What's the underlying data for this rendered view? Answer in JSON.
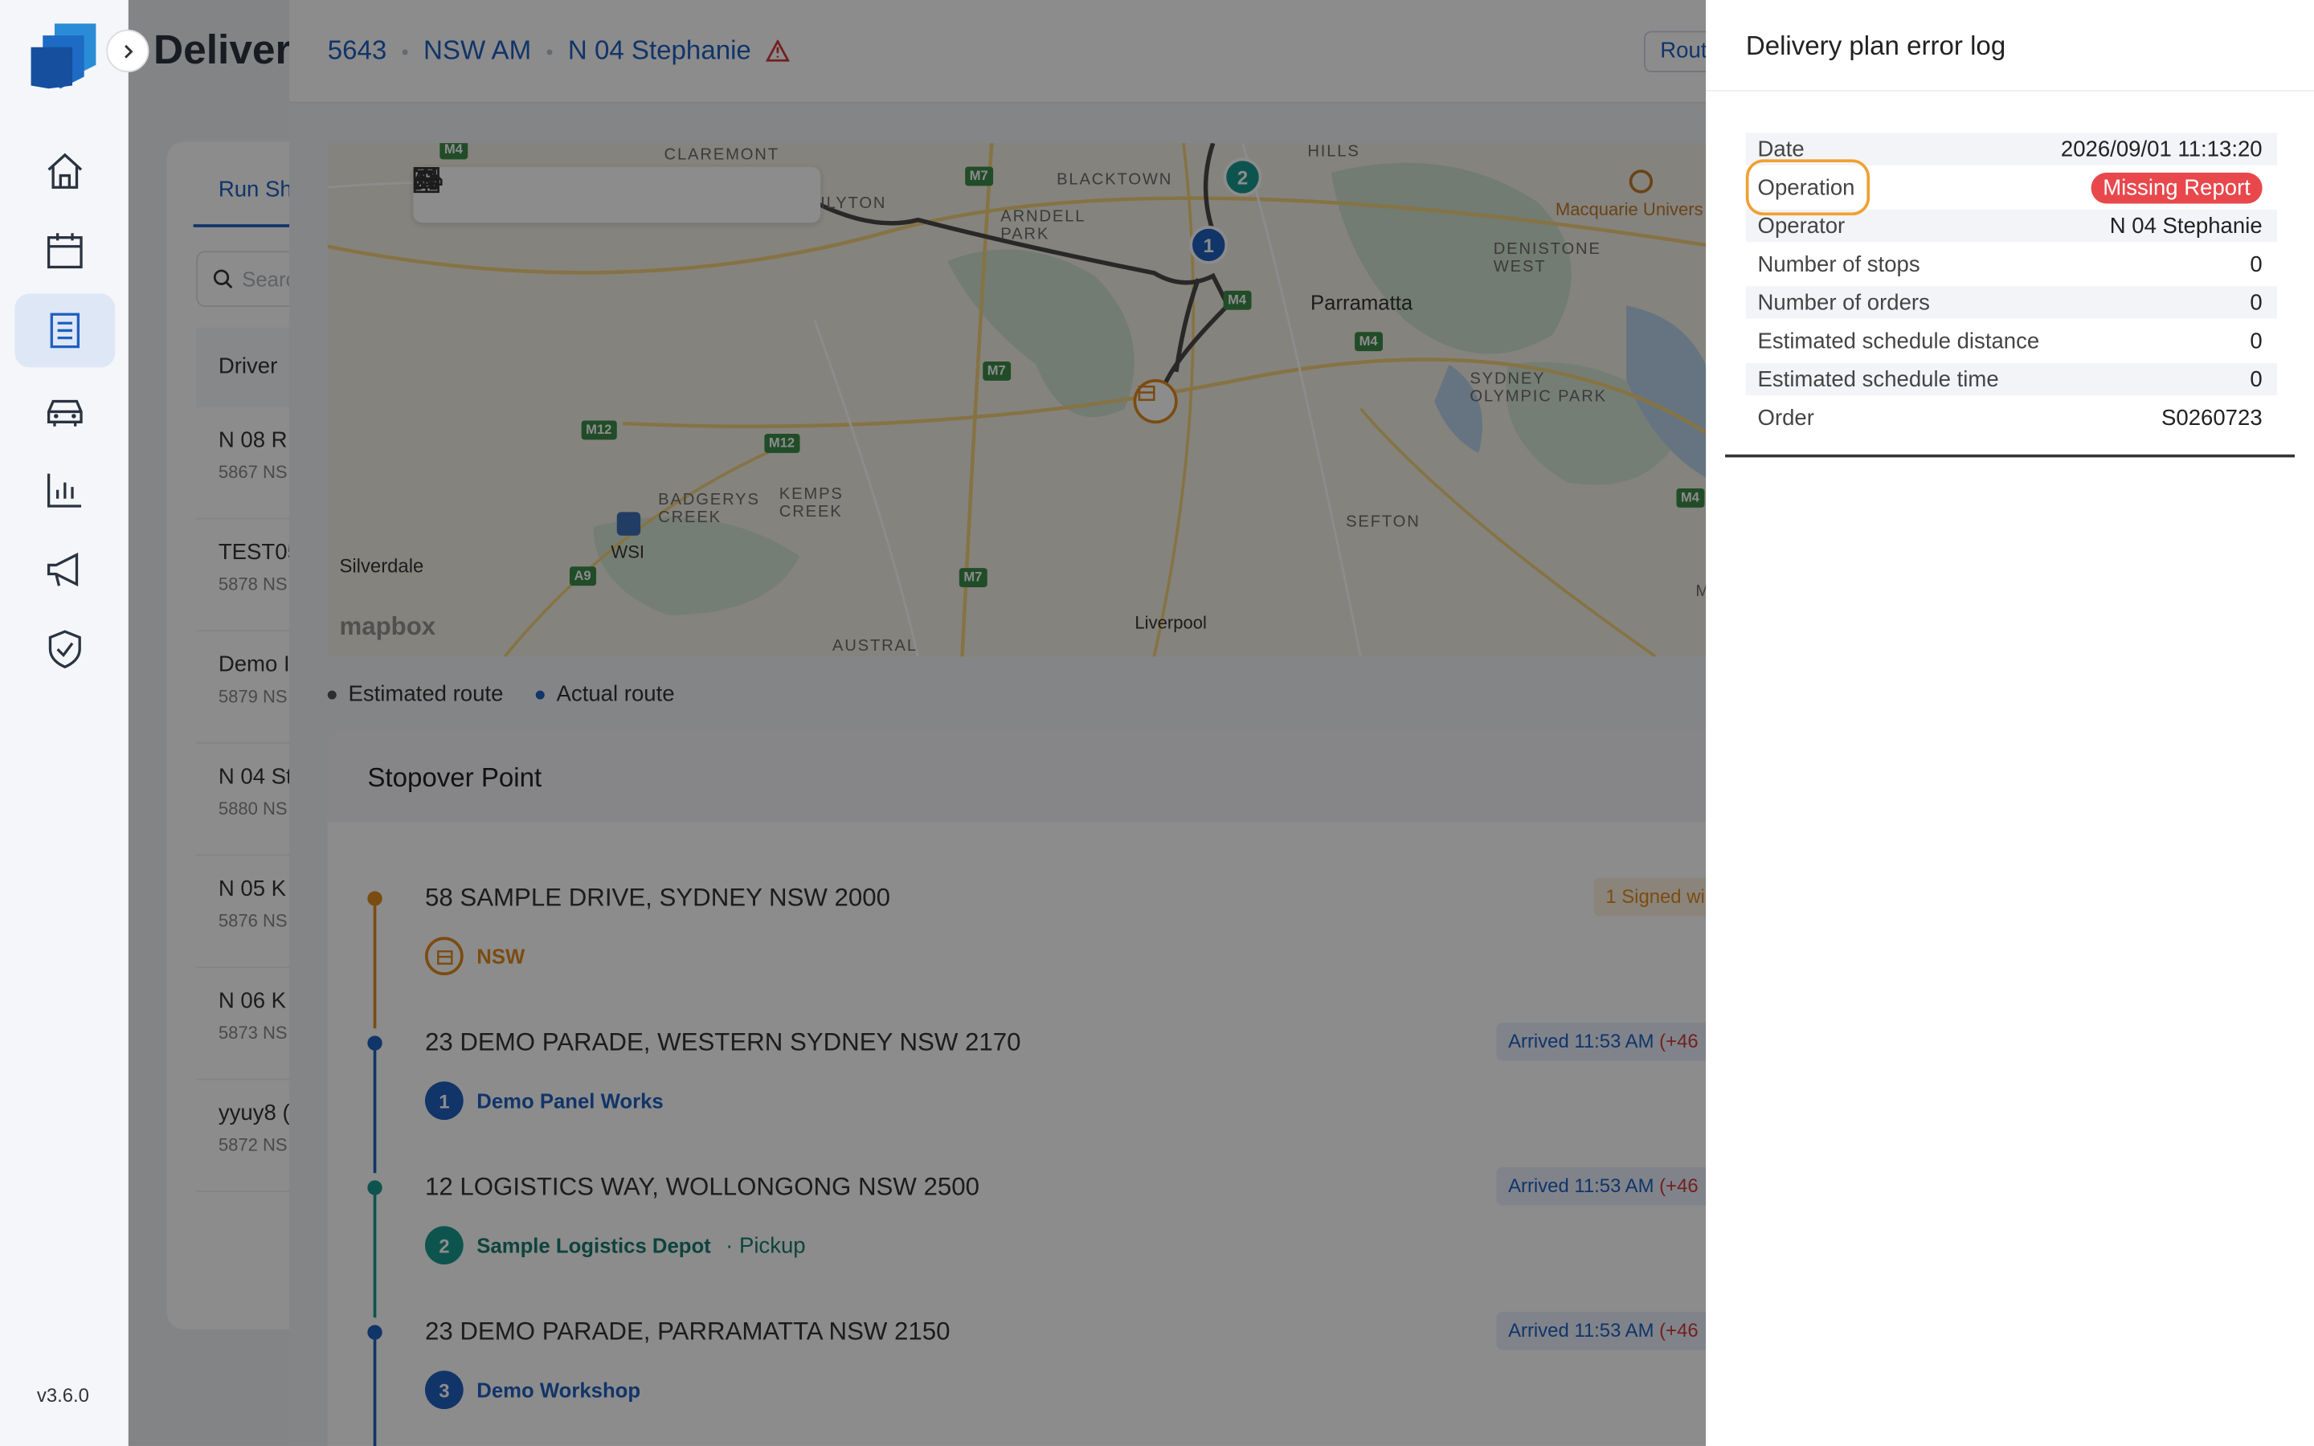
{
  "app": {
    "title": "Delivery",
    "version": "v3.6.0"
  },
  "sidebar": {
    "items": [
      {
        "id": "home",
        "icon": "home-icon"
      },
      {
        "id": "calendar",
        "icon": "calendar-icon"
      },
      {
        "id": "documents",
        "icon": "document-list-icon",
        "active": true
      },
      {
        "id": "vehicles",
        "icon": "car-icon"
      },
      {
        "id": "reports",
        "icon": "bar-chart-icon"
      },
      {
        "id": "announcements",
        "icon": "megaphone-icon"
      },
      {
        "id": "security",
        "icon": "shield-check-icon"
      }
    ]
  },
  "list": {
    "tab_label": "Run Sh",
    "search_placeholder": "Searc",
    "header": "Driver",
    "drivers": [
      {
        "name": "N 08 R",
        "sub": "5867 NS"
      },
      {
        "name": "TEST05",
        "sub": "5878 NS"
      },
      {
        "name": "Demo I",
        "sub": "5879 NS"
      },
      {
        "name": "N 04 St",
        "sub": "5880 NS"
      },
      {
        "name": "N 05 K",
        "sub": "5876 NS"
      },
      {
        "name": "N 06 K",
        "sub": "5873 NS"
      },
      {
        "name": "yyuy8 (",
        "sub": "5872 NS"
      }
    ]
  },
  "breadcrumb": {
    "id": "5643",
    "region": "NSW AM",
    "driver": "N 04 Stephanie"
  },
  "route_button": "Rout",
  "map": {
    "labels": [
      "CLAREMONT",
      "BLACKTOWN",
      "ARNDELL PARK",
      "HILLS",
      "Macquarie Univers",
      "DENISTONE WEST",
      "Parramatta",
      "SYDNEY OLYMPIC PARK",
      "BADGERYS CREEK",
      "KEMPS CREEK",
      "WSI",
      "Silverdale",
      "SEFTON",
      "Liverpool",
      "AUSTRAL",
      "ILYTON",
      "MA"
    ],
    "shields": [
      "M4",
      "M7",
      "M4",
      "M4",
      "M7",
      "M12",
      "M12",
      "M7",
      "A9",
      "M4"
    ],
    "pins": [
      "1",
      "2"
    ],
    "attribution": "mapbox"
  },
  "legend": {
    "estimated": "Estimated route",
    "actual": "Actual route"
  },
  "stopover": {
    "title": "Stopover Point",
    "stops": [
      {
        "address": "58 SAMPLE DRIVE, SYDNEY NSW 2000",
        "badge": "",
        "label": "NSW",
        "pickup": "",
        "status": "1 Signed wi",
        "delay": "",
        "color": "#e08a1e"
      },
      {
        "address": "23 DEMO PARADE, WESTERN SYDNEY NSW 2170",
        "badge": "1",
        "label": "Demo Panel Works",
        "pickup": "",
        "status": "Arrived 11:53 AM",
        "delay": "(+46",
        "color": "#1f5fbf"
      },
      {
        "address": "12 LOGISTICS WAY, WOLLONGONG NSW 2500",
        "badge": "2",
        "label": "Sample Logistics Depot",
        "pickup": "· Pickup",
        "status": "Arrived 11:53 AM",
        "delay": "(+46",
        "color": "#1a9a8e"
      },
      {
        "address": "23 DEMO PARADE, PARRAMATTA NSW 2150",
        "badge": "3",
        "label": "Demo Workshop",
        "pickup": "",
        "status": "Arrived 11:53 AM",
        "delay": "(+46",
        "color": "#1f5fbf"
      }
    ]
  },
  "drawer": {
    "title": "Delivery plan error log",
    "rows": [
      {
        "key": "Date",
        "value": "2026/09/01 11:13:20"
      },
      {
        "key": "Operation",
        "value": "Missing Report"
      },
      {
        "key": "Operator",
        "value": "N 04 Stephanie"
      },
      {
        "key": "Number of stops",
        "value": "0"
      },
      {
        "key": "Number of orders",
        "value": "0"
      },
      {
        "key": "Estimated schedule distance",
        "value": "0"
      },
      {
        "key": "Estimated schedule time",
        "value": "0"
      },
      {
        "key": "Order",
        "value": "S0260723"
      }
    ]
  },
  "colors": {
    "accent": "#1f5fbf",
    "error": "#e8484c",
    "highlight": "#f0a030"
  }
}
